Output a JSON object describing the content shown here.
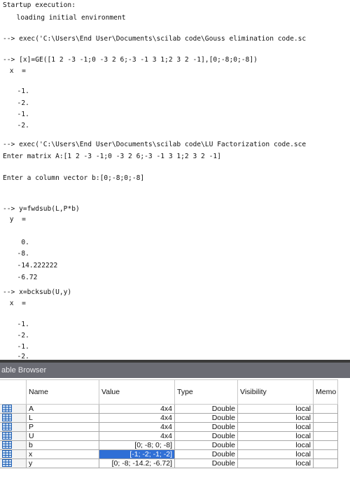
{
  "console": {
    "lines": [
      "Startup execution:",
      "  loading initial environment",
      "",
      "--> exec('C:\\Users\\End User\\Documents\\scilab code\\Gouss elimination code.sc",
      "",
      "--> [x]=GE([1 2 -3 -1;0 -3 2 6;-3 -1 3 1;2 3 2 -1],[0;-8;0;-8])",
      " x  =",
      "",
      "  -1.",
      "  -2.",
      "  -1.",
      "  -2.",
      "",
      "--> exec('C:\\Users\\End User\\Documents\\scilab code\\LU Factorization code.sce",
      "Enter matrix A:[1 2 -3 -1;0 -3 2 6;-3 -1 3 1;2 3 2 -1]",
      "",
      "Enter a column vector b:[0;-8;0;-8]",
      "",
      "",
      "--> y=fwdsub(L,P*b)",
      " y  =",
      "",
      "   0.",
      "  -8.",
      "  -14.222222",
      "  -6.72",
      "",
      "--> x=bcksub(U,y)",
      " x  =",
      "",
      "  -1.",
      "  -2.",
      "  -1.",
      "  -2."
    ]
  },
  "variable_browser": {
    "title": "able Browser",
    "columns": [
      "Name",
      "Value",
      "Type",
      "Visibility",
      "Memo"
    ],
    "rows": [
      {
        "name": "A",
        "value": "4x4",
        "type": "Double",
        "visibility": "local"
      },
      {
        "name": "L",
        "value": "4x4",
        "type": "Double",
        "visibility": "local"
      },
      {
        "name": "P",
        "value": "4x4",
        "type": "Double",
        "visibility": "local"
      },
      {
        "name": "U",
        "value": "4x4",
        "type": "Double",
        "visibility": "local"
      },
      {
        "name": "b",
        "value": "[0; -8; 0; -8]",
        "type": "Double",
        "visibility": "local"
      },
      {
        "name": "x",
        "value": "[-1; -2; -1; -2]",
        "type": "Double",
        "visibility": "local"
      },
      {
        "name": "y",
        "value": "[0; -8; -14.2; -6.72]",
        "type": "Double",
        "visibility": "local"
      }
    ],
    "selected_row": 5,
    "colors": {
      "title_bar": "#6b6c74",
      "selection": "#2f6fd6",
      "icon": "#1e5fb4"
    },
    "row_icon": "matrix-grid-icon"
  }
}
